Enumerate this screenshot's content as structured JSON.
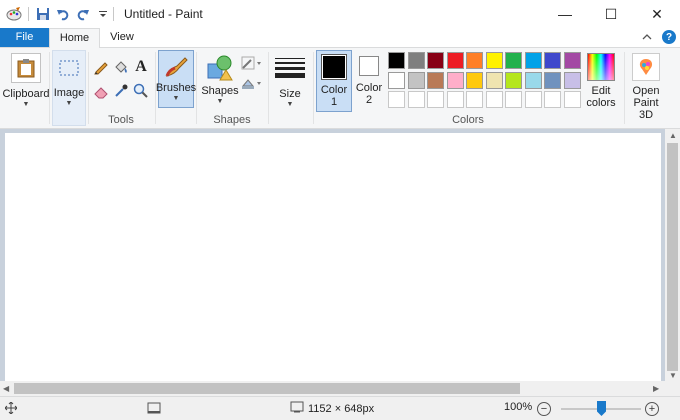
{
  "window": {
    "title": "Untitled - Paint",
    "controls": {
      "minimize": "—",
      "maximize": "☐",
      "close": "✕"
    }
  },
  "tabs": {
    "file": "File",
    "home": "Home",
    "view": "View"
  },
  "ribbon": {
    "clipboard": "Clipboard",
    "image": "Image",
    "tools_group": "Tools",
    "brushes": "Brushes",
    "shapes_btn": "Shapes",
    "shapes_group": "Shapes",
    "size": "Size",
    "color1_line1": "Color",
    "color1_line2": "1",
    "color2_line1": "Color",
    "color2_line2": "2",
    "edit_colors_line1": "Edit",
    "edit_colors_line2": "colors",
    "colors_group": "Colors",
    "open_paint3d_line1": "Open",
    "open_paint3d_line2": "Paint 3D",
    "text_tool_glyph": "A",
    "help_glyph": "?"
  },
  "colors": {
    "accent": "#1979ca",
    "color1": "#000000",
    "color2": "#ffffff",
    "palette_row1": [
      "#000000",
      "#7f7f7f",
      "#880015",
      "#ed1c24",
      "#ff7f27",
      "#fff200",
      "#22b14c",
      "#00a2e8",
      "#3f48cc",
      "#a349a4"
    ],
    "palette_row2": [
      "#ffffff",
      "#c3c3c3",
      "#b97a57",
      "#ffaec9",
      "#ffc90e",
      "#efe4b0",
      "#b5e61d",
      "#99d9ea",
      "#7092be",
      "#c8bfe7"
    ],
    "palette_row3": [
      "#ffffff",
      "#ffffff",
      "#ffffff",
      "#ffffff",
      "#ffffff",
      "#ffffff",
      "#ffffff",
      "#ffffff",
      "#ffffff",
      "#ffffff"
    ]
  },
  "status": {
    "dimensions": "1152 × 648px",
    "zoom": "100%",
    "zoom_out": "−",
    "zoom_in": "+",
    "zoom_fraction": 0.5
  }
}
